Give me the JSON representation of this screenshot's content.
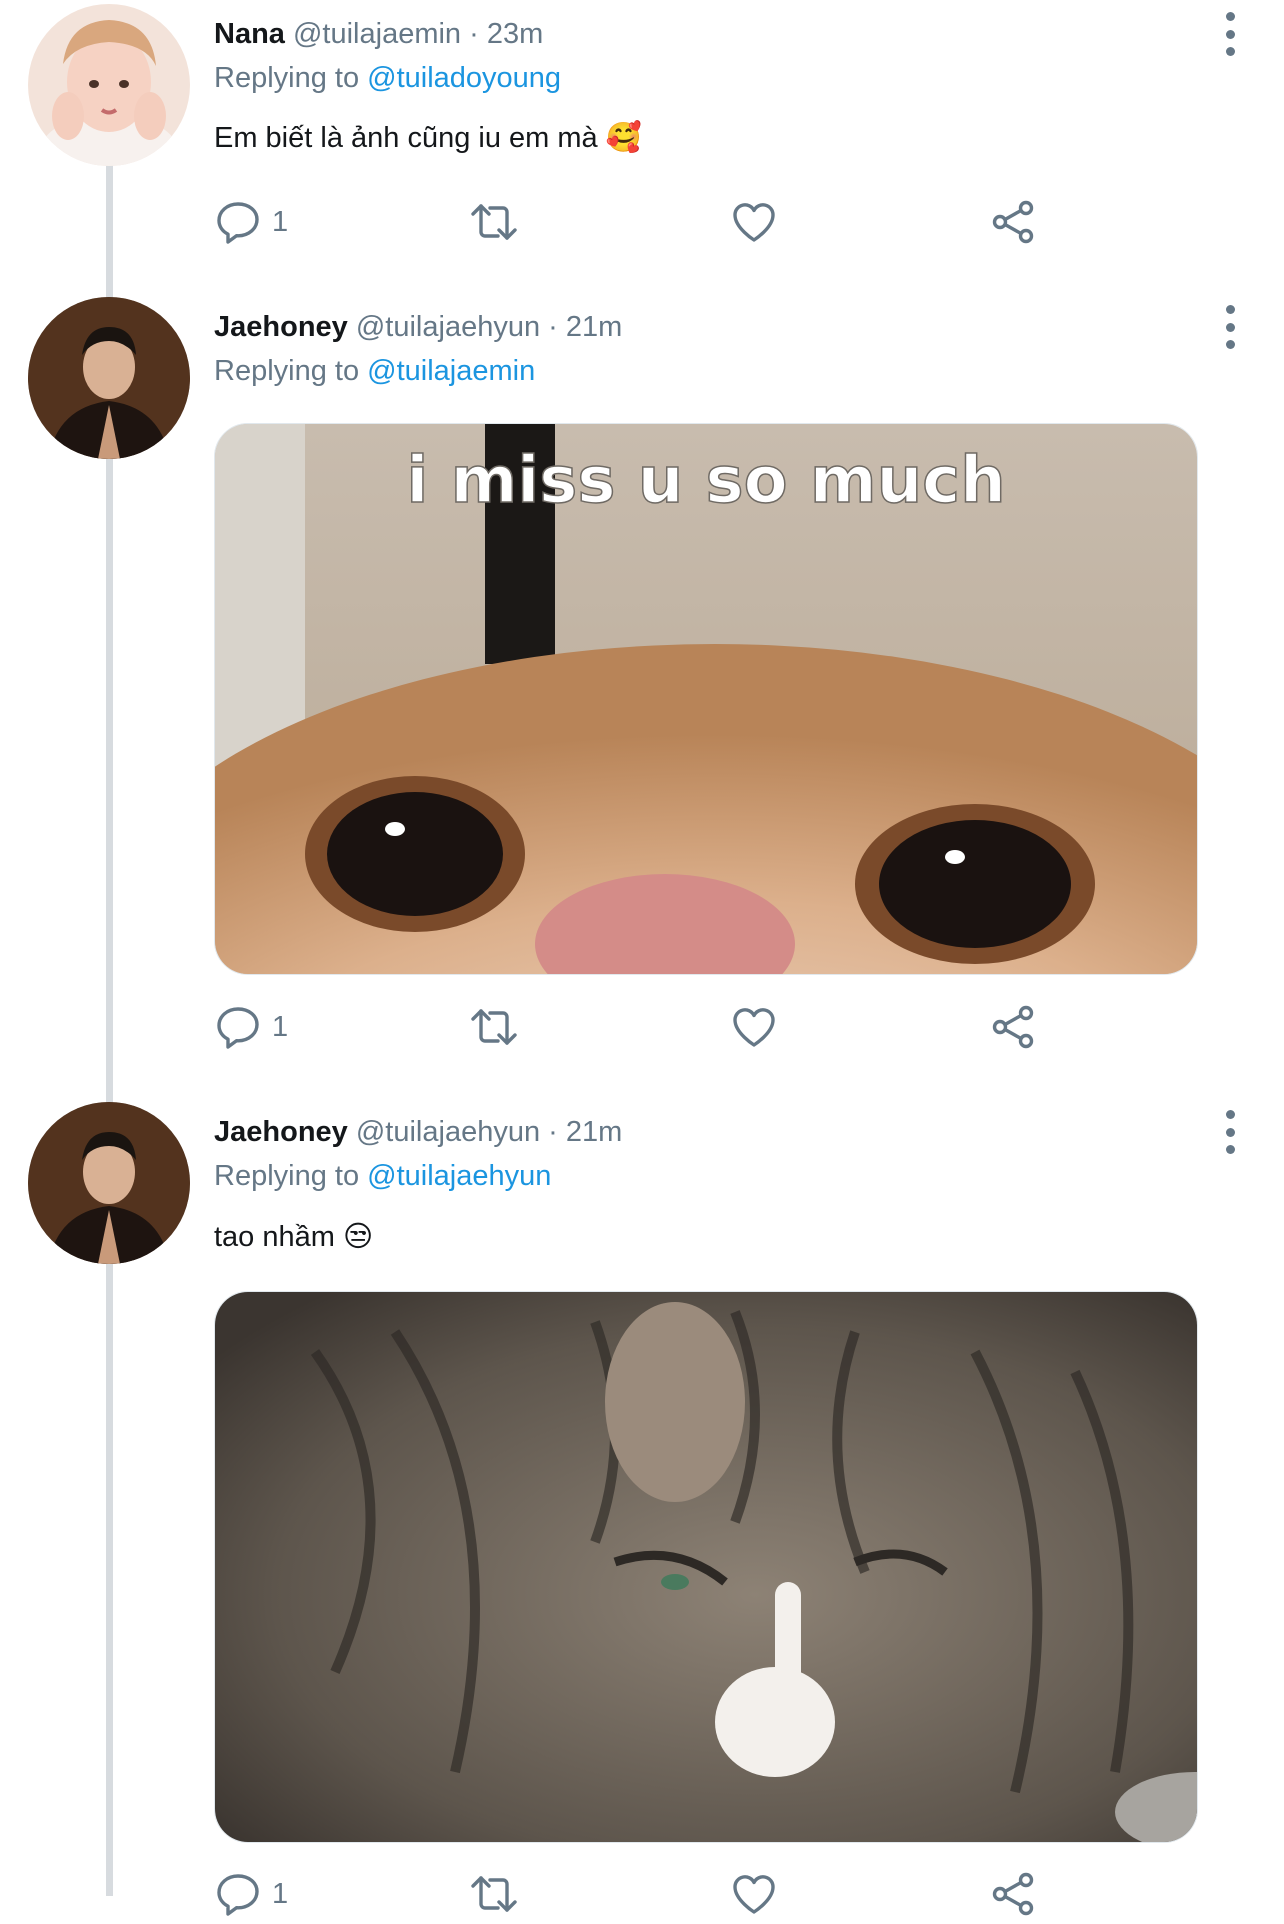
{
  "replies": [
    {
      "name": "Nana",
      "handle": "@tuilajaemin",
      "time": "23m",
      "replying_to": "@tuiladoyoung",
      "replying_label": "Replying to",
      "text": "Em biết là ảnh cũng iu em mà 🥰",
      "reply_count": "1"
    },
    {
      "name": "Jaehoney",
      "handle": "@tuilajaehyun",
      "time": "21m",
      "replying_to": "@tuilajaemin",
      "replying_label": "Replying to",
      "media_caption": "i miss u so much",
      "reply_count": "1"
    },
    {
      "name": "Jaehoney",
      "handle": "@tuilajaehyun",
      "time": "21m",
      "replying_to": "@tuilajaehyun",
      "replying_label": "Replying to",
      "text": "tao nhầm 😒",
      "reply_count": "1"
    }
  ],
  "separator": "·",
  "colors": {
    "muted": "#657786",
    "link": "#1b95e0",
    "thread_line": "#d7dbdf"
  },
  "icons": [
    "reply-icon",
    "retweet-icon",
    "like-icon",
    "share-icon",
    "more-options-icon"
  ]
}
